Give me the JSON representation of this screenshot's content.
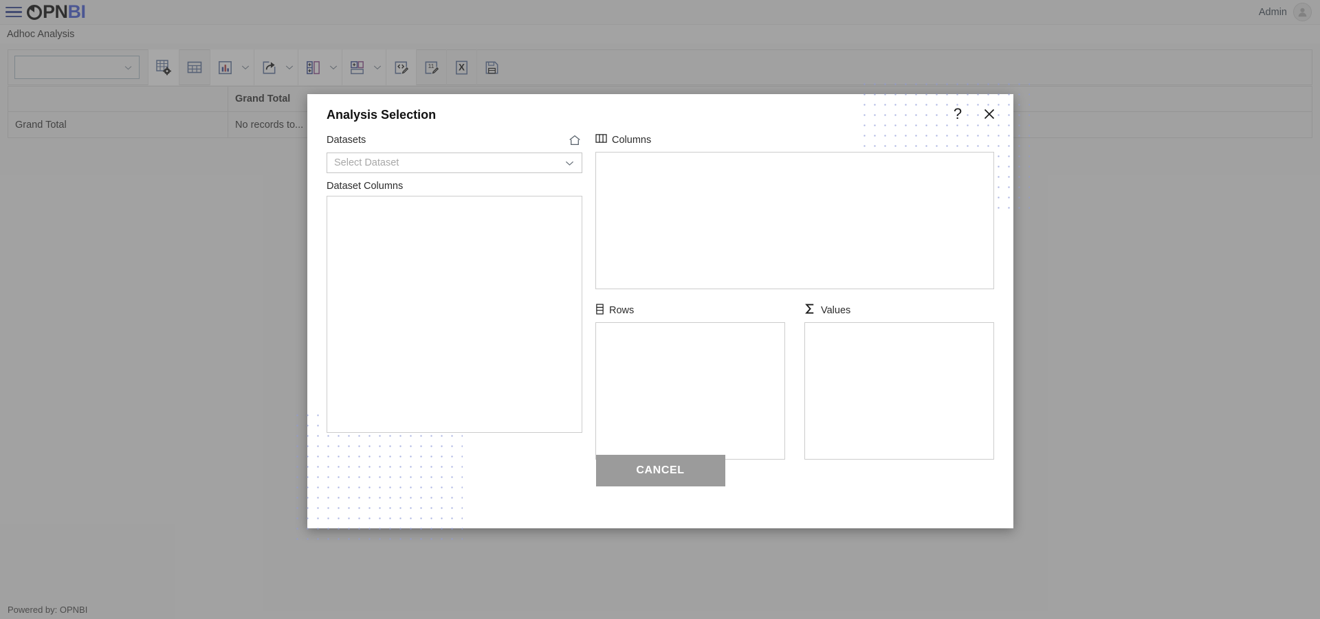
{
  "header": {
    "menu_icon": "hamburger-menu-icon",
    "brand_dark": "PN",
    "brand_blue": "BI",
    "brand_pie_icon": "pie-chart-logo-icon",
    "user_label": "Admin",
    "avatar_icon": "user-avatar-icon"
  },
  "page": {
    "title": "Adhoc Analysis"
  },
  "toolbar": {
    "dataset_select_value": "",
    "dataset_select_caret_icon": "chevron-down-icon",
    "buttons": [
      {
        "name": "table-settings-button",
        "icon": "table-gear-icon",
        "caret": false,
        "label": "Table Settings"
      },
      {
        "name": "grid-view-button",
        "icon": "table-grid-icon",
        "caret": false,
        "label": "Grid View"
      },
      {
        "name": "chart-button",
        "icon": "bar-chart-icon",
        "caret": true,
        "label": "Chart"
      },
      {
        "name": "export-button",
        "icon": "share-export-icon",
        "caret": true,
        "label": "Export"
      },
      {
        "name": "insert-column-button",
        "icon": "add-column-icon",
        "caret": true,
        "label": "Insert Column"
      },
      {
        "name": "insert-row-button",
        "icon": "add-row-icon",
        "caret": true,
        "label": "Insert Row"
      },
      {
        "name": "edit-expression-button",
        "icon": "code-edit-icon",
        "caret": false,
        "label": "Edit Expression"
      },
      {
        "name": "edit-number-format-button",
        "icon": "number-edit-icon",
        "caret": false,
        "label": "Number Format"
      },
      {
        "name": "excel-export-button",
        "icon": "excel-x-icon",
        "caret": false,
        "label": "Export to Excel"
      },
      {
        "name": "save-button",
        "icon": "save-disk-icon",
        "caret": false,
        "label": "Save"
      }
    ]
  },
  "pivot": {
    "header_row": {
      "col1": "",
      "col2": "Grand Total"
    },
    "body_rows": [
      {
        "col1": "Grand Total",
        "col2": "No records to..."
      }
    ]
  },
  "footer": {
    "text": "Powered by: OPNBI"
  },
  "modal": {
    "title": "Analysis Selection",
    "help_icon": "question-mark-help-icon",
    "help_label": "?",
    "close_icon": "close-x-icon",
    "datasets": {
      "label": "Datasets",
      "home_icon": "home-icon",
      "select_placeholder": "Select Dataset",
      "select_value": "",
      "caret_icon": "chevron-down-icon",
      "columns_label": "Dataset Columns",
      "columns_items": []
    },
    "zones": {
      "columns": {
        "label": "Columns",
        "icon": "columns-layout-icon",
        "items": []
      },
      "rows": {
        "label": "Rows",
        "icon": "rows-layout-icon",
        "items": []
      },
      "values": {
        "label": "Values",
        "icon": "sigma-sum-icon",
        "items": []
      }
    },
    "cancel_label": "CANCEL"
  },
  "colors": {
    "brand_blue": "#3a4a9f",
    "brand_dark": "#111111",
    "page_bg": "#b4b4b4",
    "modal_bg": "#ffffff",
    "cancel_bg": "#9b9b9b",
    "dot_pattern": "#8e9ad8"
  }
}
